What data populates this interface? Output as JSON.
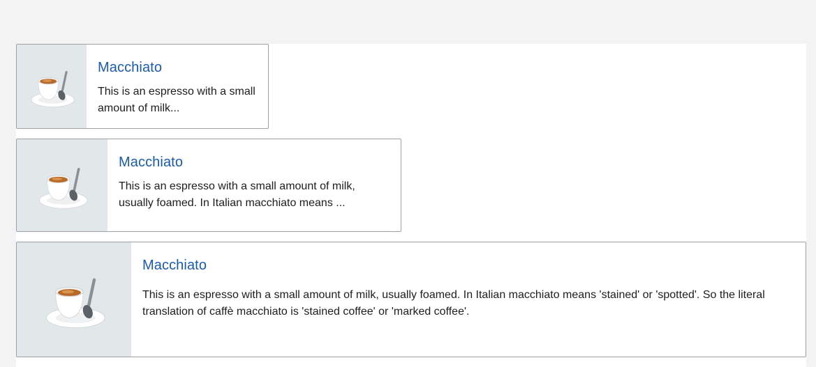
{
  "cards": [
    {
      "title": "Macchiato",
      "description": "This is an espresso with a small amount of milk...",
      "image": "espresso-cup-icon"
    },
    {
      "title": "Macchiato",
      "description": "This is an espresso with a small amount of milk, usually foamed. In Italian macchiato means ...",
      "image": "espresso-cup-icon"
    },
    {
      "title": "Macchiato",
      "description": "This is an espresso with a small amount of milk, usually foamed. In Italian macchiato means 'stained' or 'spotted'. So the literal translation of caffè macchiato is 'stained coffee' or 'marked coffee'.",
      "image": "espresso-cup-icon"
    }
  ],
  "colors": {
    "page_background": "#f3f3f3",
    "title": "#1a5bb0",
    "text": "#1d1d1d",
    "border": "#9aa0a6",
    "thumb_background": "#e2e7ea"
  }
}
